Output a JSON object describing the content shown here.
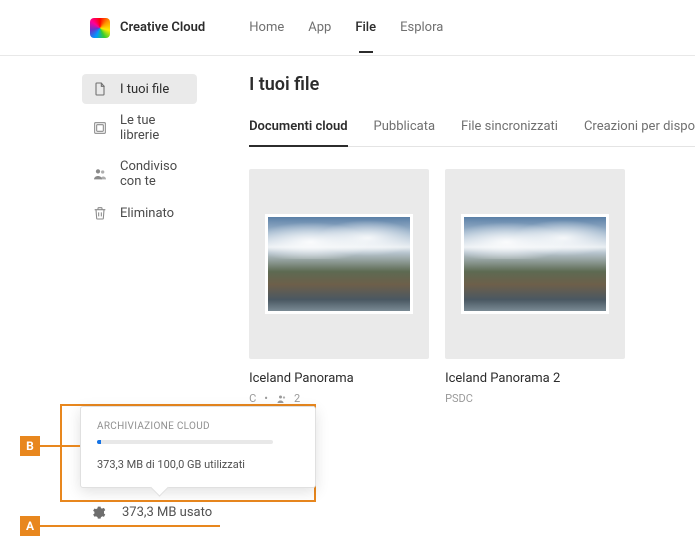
{
  "brand": {
    "name": "Creative Cloud"
  },
  "nav": {
    "home": "Home",
    "app": "App",
    "file": "File",
    "esplora": "Esplora"
  },
  "sidebar": {
    "items": [
      {
        "label": "I tuoi file"
      },
      {
        "label": "Le tue librerie"
      },
      {
        "label": "Condiviso con te"
      },
      {
        "label": "Eliminato"
      }
    ]
  },
  "page": {
    "title": "I tuoi file"
  },
  "tabs": {
    "cloud": "Documenti cloud",
    "pub": "Pubblicata",
    "sync": "File sincronizzati",
    "disp": "Creazioni per dispo"
  },
  "files": [
    {
      "name": "Iceland Panorama",
      "type_suffix": "C",
      "shared": "2"
    },
    {
      "name": "Iceland Panorama 2",
      "type": "PSDC"
    }
  ],
  "storage": {
    "popover_title": "ARCHIVIAZIONE CLOUD",
    "popover_text": "373,3 MB di 100,0 GB utilizzati",
    "footer_text": "373,3 MB usato"
  },
  "markers": {
    "a": "A",
    "b": "B"
  }
}
